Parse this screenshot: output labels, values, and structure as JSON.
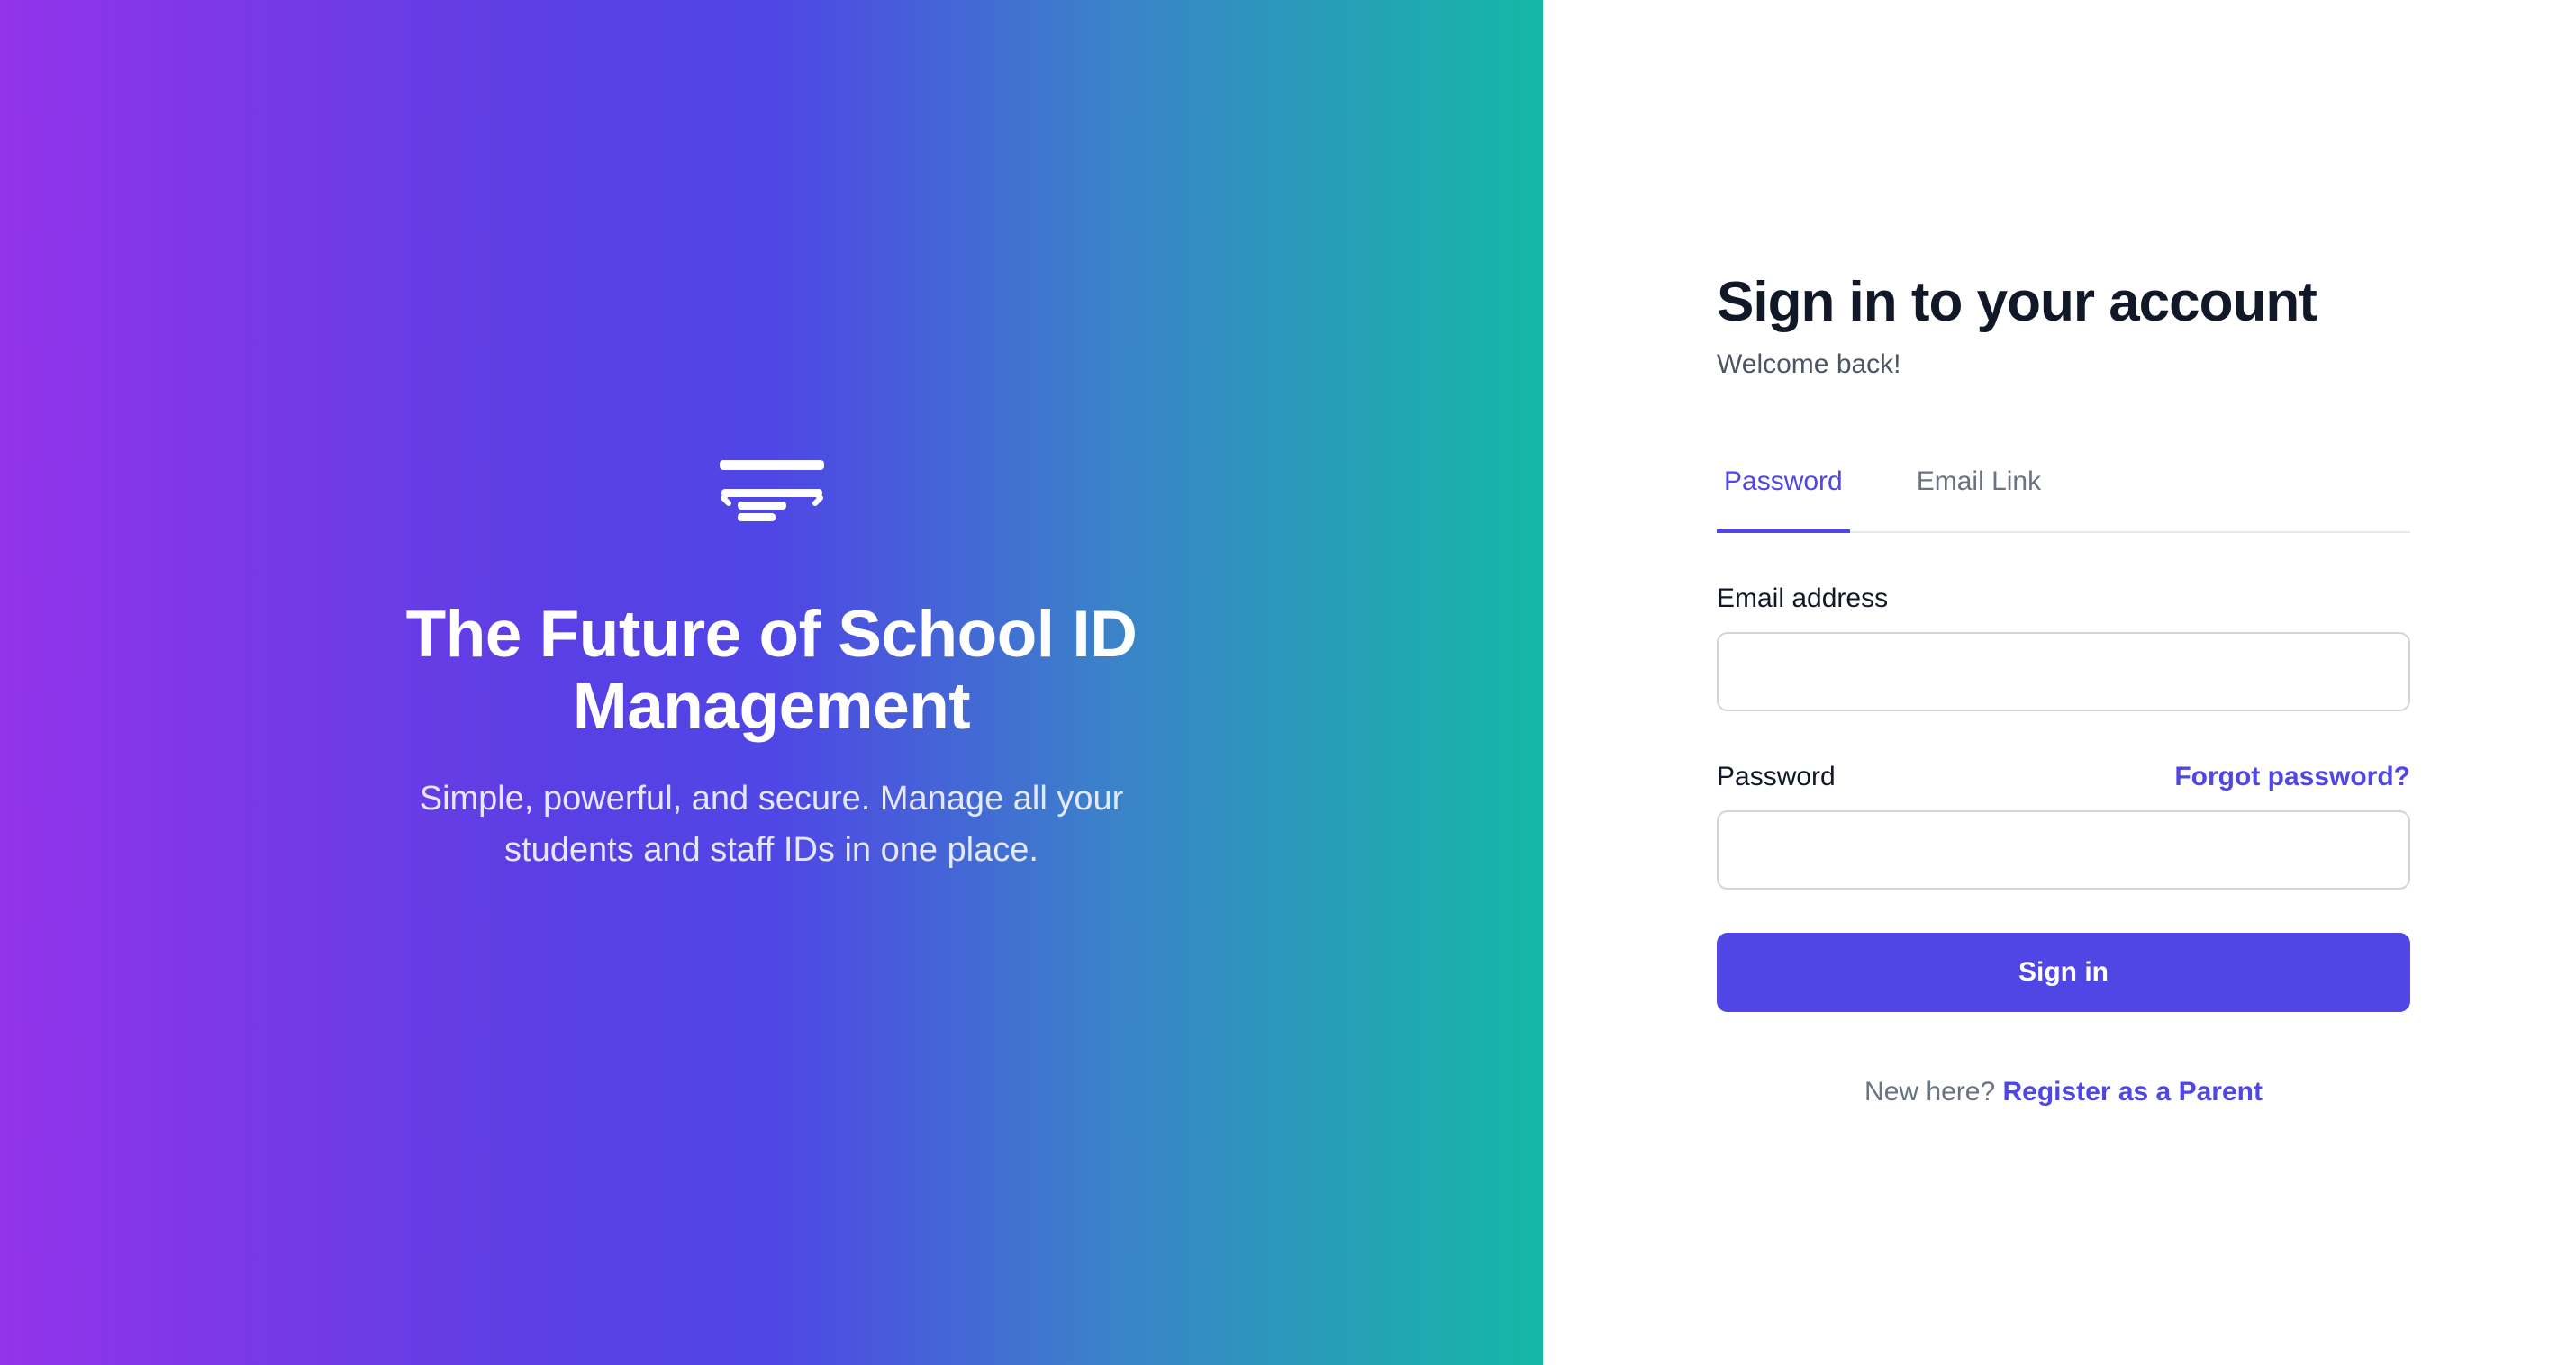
{
  "hero": {
    "logo_icon": "id-card-stack-icon",
    "title": "The Future of School ID Management",
    "subtitle": "Simple, powerful, and secure. Manage all your students and staff IDs in one place."
  },
  "auth": {
    "title": "Sign in to your account",
    "welcome": "Welcome back!",
    "tabs": [
      {
        "label": "Password",
        "active": true
      },
      {
        "label": "Email Link",
        "active": false
      }
    ],
    "email": {
      "label": "Email address",
      "value": "",
      "placeholder": ""
    },
    "password": {
      "label": "Password",
      "value": "",
      "placeholder": "",
      "forgot_label": "Forgot password?"
    },
    "submit_label": "Sign in",
    "register_prompt": "New here?",
    "register_link": "Register as a Parent"
  },
  "colors": {
    "accent": "#4f46e5",
    "gradient_start": "#9333ea",
    "gradient_mid": "#4f46e5",
    "gradient_end": "#14b8a6",
    "heading": "#111827",
    "muted": "#6b7280"
  }
}
